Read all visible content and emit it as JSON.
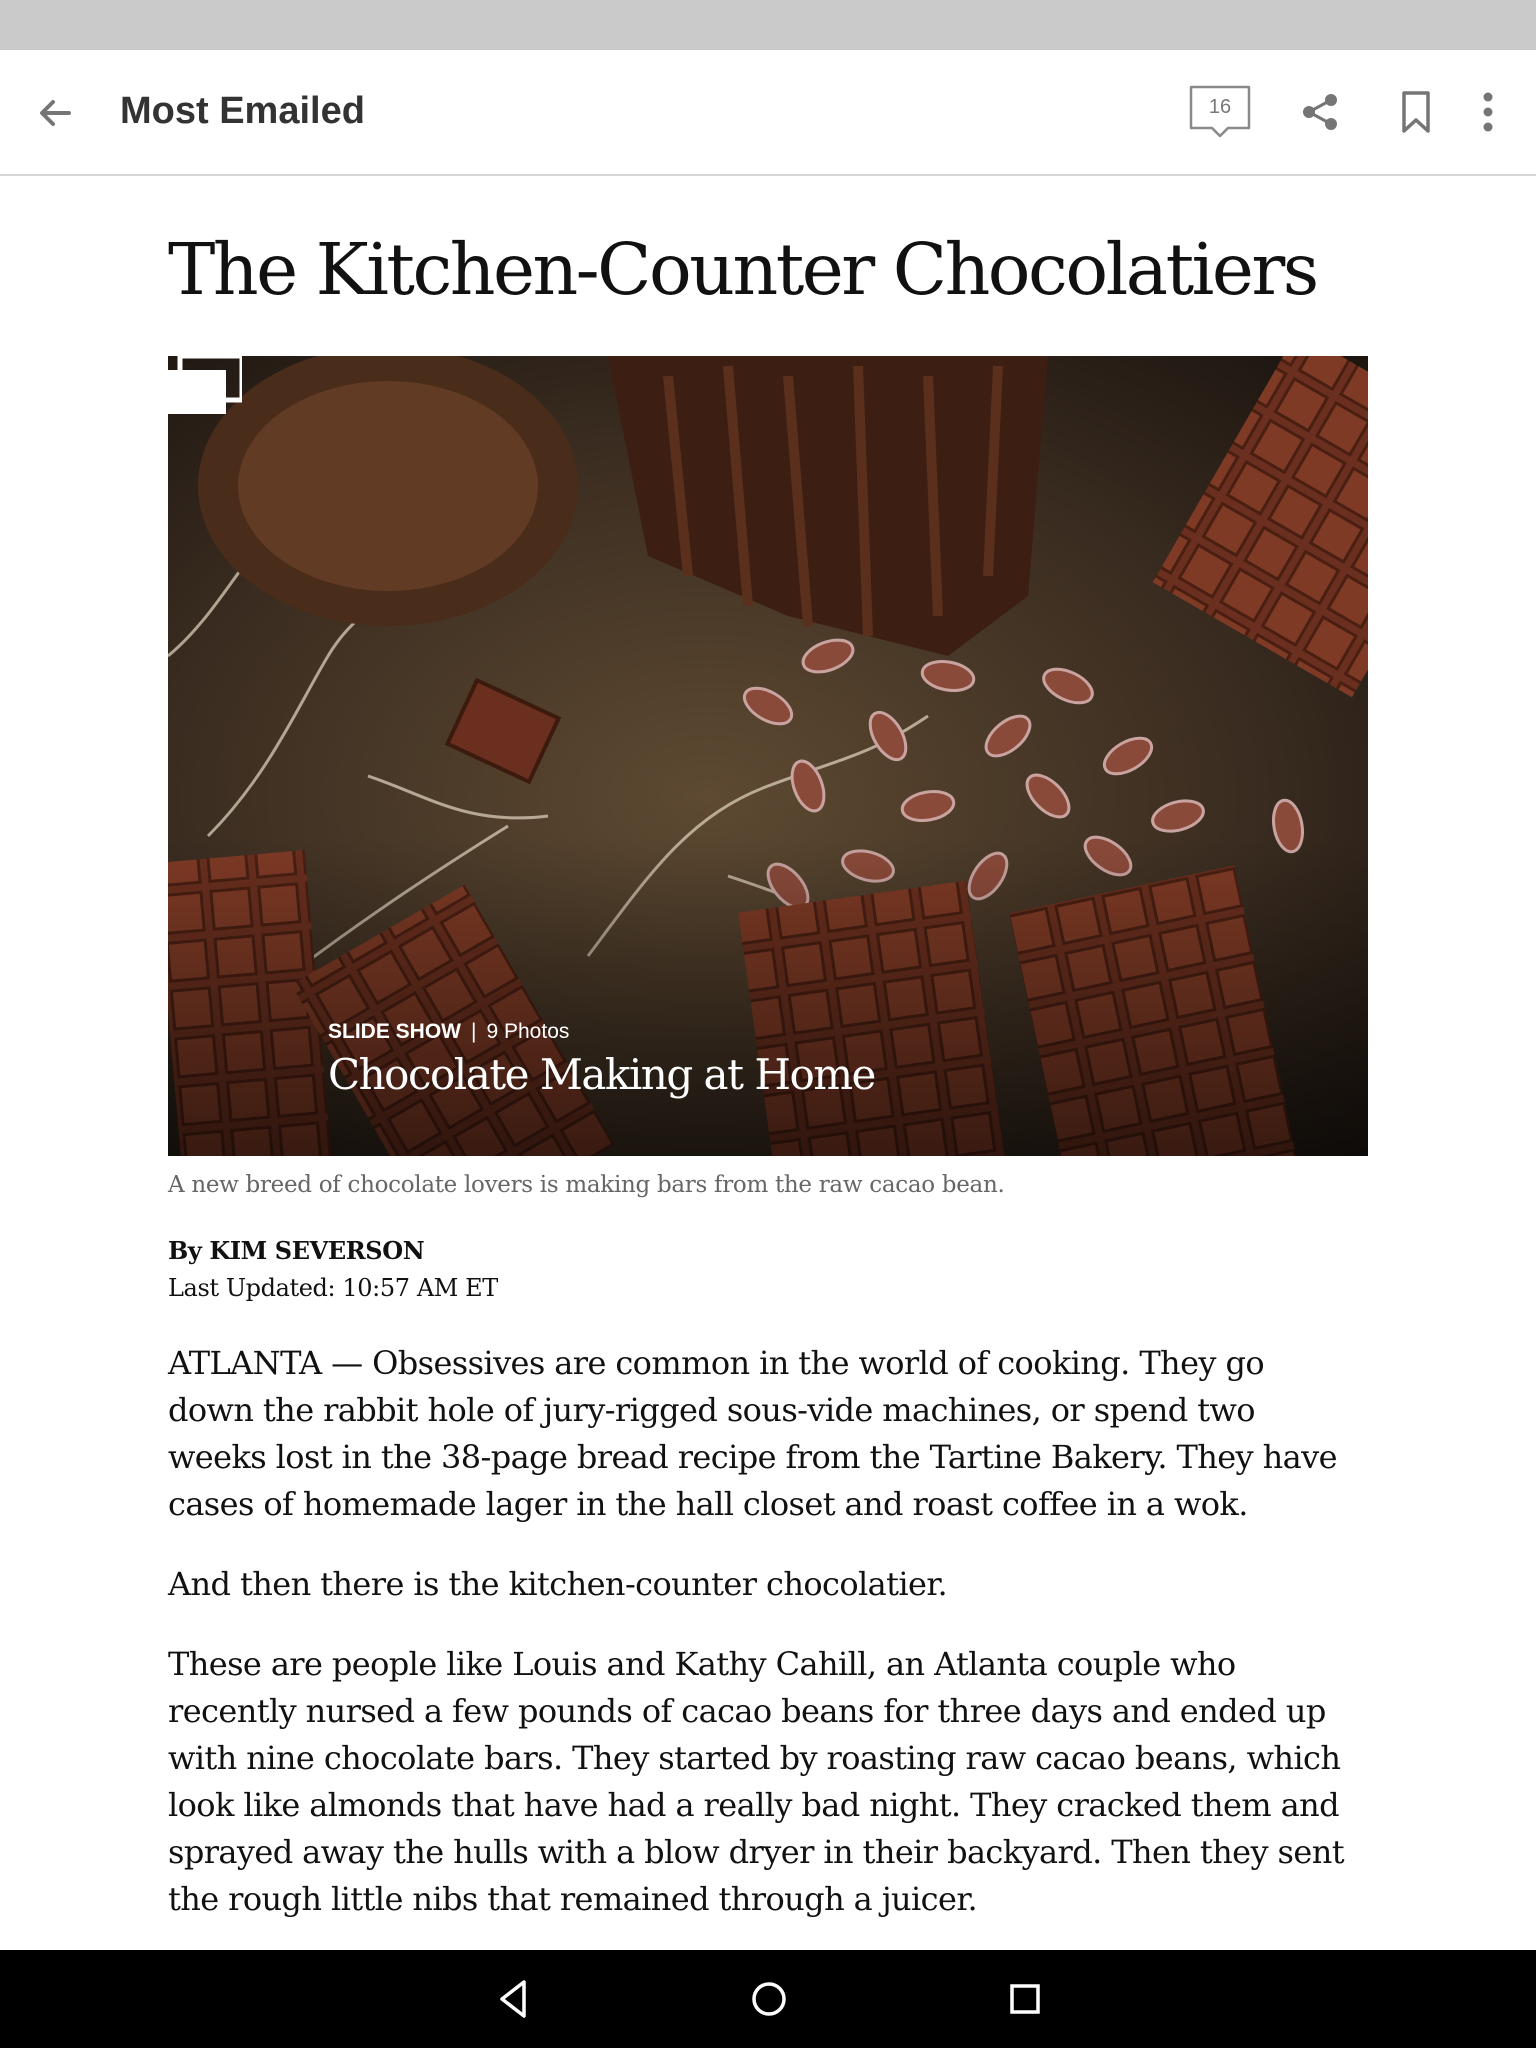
{
  "app_bar": {
    "title": "Most Emailed",
    "comment_count": "16",
    "icons": [
      "back-arrow-icon",
      "comment-icon",
      "share-icon",
      "bookmark-icon",
      "more-vert-icon"
    ]
  },
  "article": {
    "headline": "The Kitchen-Counter Chocolatiers",
    "hero": {
      "slideshow_label": "SLIDE SHOW",
      "separator": "|",
      "photo_count": "9 Photos",
      "slideshow_title": "Chocolate Making at Home"
    },
    "caption": "A new breed of chocolate lovers is making bars from the raw cacao bean.",
    "byline": "By KIM SEVERSON",
    "updated": "Last Updated: 10:57 AM ET",
    "paragraphs": [
      "ATLANTA — Obsessives are common in the world of cooking. They go down the rabbit hole of jury-rigged sous-vide machines, or spend two weeks lost in the 38-page bread recipe from the Tartine Bakery. They have cases of homemade lager in the hall closet and roast coffee in a wok.",
      "And then there is the kitchen-counter chocolatier.",
      "These are people like Louis and Kathy Cahill, an Atlanta couple who recently nursed a few pounds of cacao beans for three days and ended up with nine chocolate bars. They started by roasting raw cacao beans, which look like almonds that have had a really bad night. They cracked them and sprayed away the hulls with a blow dryer in their backyard. Then they sent the rough little nibs that remained through a juicer."
    ]
  },
  "nav_bar": {
    "icons": [
      "nav-back-icon",
      "nav-home-icon",
      "nav-recents-icon"
    ]
  },
  "colors": {
    "status_bar": "#cacaca",
    "nav_bar": "#000000",
    "text": "#111111",
    "caption": "#666666"
  }
}
